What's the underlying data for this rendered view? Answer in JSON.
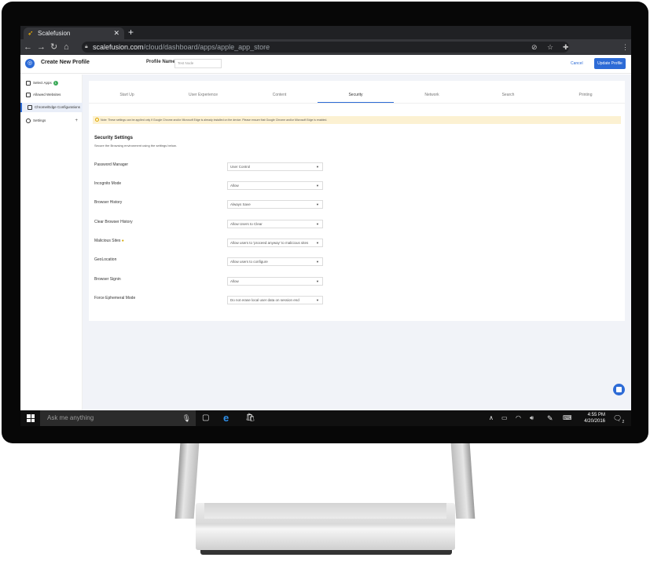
{
  "browser": {
    "tab_title": "Scalefusion",
    "url_host": "scalefusion.com",
    "url_path": "/cloud/dashboard/apps/apple_app_store"
  },
  "header": {
    "title": "Create New Profile",
    "profile_name_label": "Profile Name",
    "profile_name_value": "Test Node",
    "cancel_label": "Cancel",
    "update_label": "Update Profile"
  },
  "sidebar": {
    "items": [
      {
        "label": "Select Apps",
        "badge": "1"
      },
      {
        "label": "Allowed Websites"
      },
      {
        "label": "Chrome/Edge Configurations"
      },
      {
        "label": "Settings"
      }
    ]
  },
  "tabs": [
    "Start Up",
    "User Experience",
    "Content",
    "Security",
    "Network",
    "Search",
    "Printing"
  ],
  "active_tab": "Security",
  "note": "Note: These settings can be applied only if Google Chrome and/or Microsoft Edge is already installed on the device. Please ensure that Google Chrome and/or Microsoft Edge is enabled.",
  "section": {
    "title": "Security Settings",
    "subtitle": "Secure the Browsing environment using the settings below."
  },
  "fields": [
    {
      "label": "Password Manager",
      "value": "User Control"
    },
    {
      "label": "Incognito Mode",
      "value": "Allow"
    },
    {
      "label": "Browser History",
      "value": "Always Save"
    },
    {
      "label": "Clear Browser History",
      "value": "Allow Users to Clear"
    },
    {
      "label": "Malicious Sites",
      "value": "Allow users to 'proceed anyway' to malicious sites"
    },
    {
      "label": "GeoLocation",
      "value": "Allow users to configure"
    },
    {
      "label": "Browser Signin",
      "value": "Allow"
    },
    {
      "label": "Force Ephemeral Mode",
      "value": "Do not erase local user data on session end"
    }
  ],
  "taskbar": {
    "search_placeholder": "Ask me anything",
    "time": "4:55 PM",
    "date": "4/20/2016",
    "notification_count": "2"
  },
  "colors": {
    "accent": "#2d6bd6",
    "note_bg": "#fcf1d2",
    "badge": "#3caa5a"
  }
}
